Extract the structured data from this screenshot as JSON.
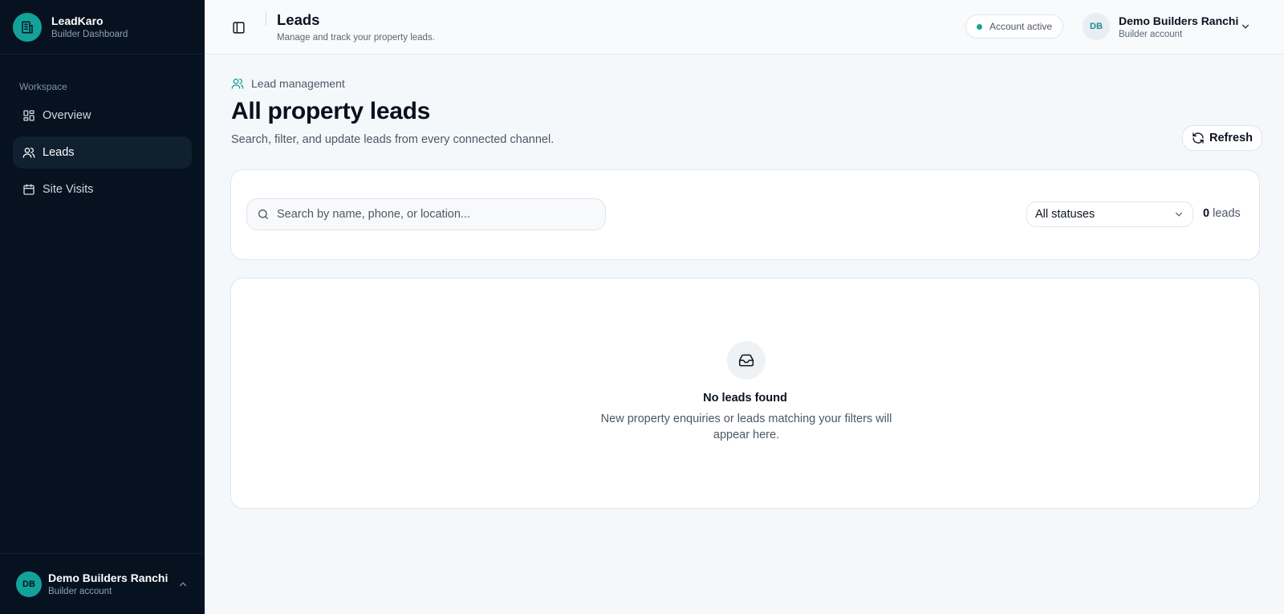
{
  "brand": {
    "name": "LeadKaro",
    "subtitle": "Builder Dashboard"
  },
  "sidebar": {
    "section_label": "Workspace",
    "items": [
      {
        "label": "Overview",
        "icon": "grid-icon",
        "active": false
      },
      {
        "label": "Leads",
        "icon": "users-icon",
        "active": true
      },
      {
        "label": "Site Visits",
        "icon": "calendar-icon",
        "active": false
      }
    ],
    "footer": {
      "initials": "DB",
      "name": "Demo Builders Ranchi",
      "role": "Builder account"
    }
  },
  "header": {
    "title": "Leads",
    "subtitle": "Manage and track your property leads.",
    "status": "Account active",
    "user": {
      "initials": "DB",
      "name": "Demo Builders Ranchi",
      "role": "Builder account"
    }
  },
  "main": {
    "breadcrumb": "Lead management",
    "title": "All property leads",
    "description": "Search, filter, and update leads from every connected channel.",
    "refresh_label": "Refresh",
    "search": {
      "placeholder": "Search by name, phone, or location...",
      "value": ""
    },
    "status_filter": {
      "selected": "All statuses"
    },
    "lead_count": {
      "count": "0",
      "unit": "leads"
    },
    "empty_state": {
      "title": "No leads found",
      "description": "New property enquiries or leads matching your filters will appear here."
    }
  },
  "colors": {
    "accent": "#12a29a",
    "sidebar_bg": "#06121f",
    "status_dot": "#14a594"
  }
}
